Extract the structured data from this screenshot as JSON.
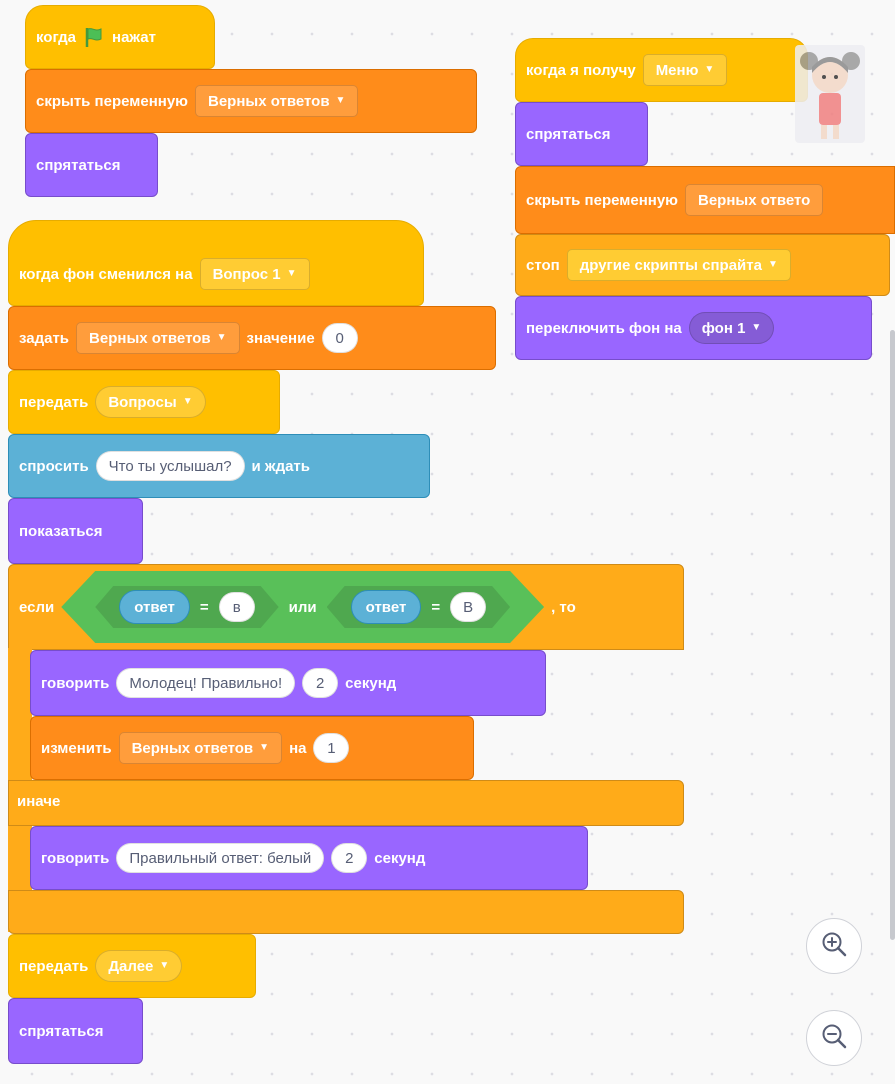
{
  "script1": {
    "hat_when": "когда",
    "hat_clicked": "нажат",
    "hide_var_label": "скрыть переменную",
    "hide_var_value": "Верных ответов",
    "hide_label": "спрятаться"
  },
  "script2": {
    "hat_label": "когда фон сменился на",
    "hat_value": "Вопрос 1",
    "set_label": "задать",
    "set_var": "Верных ответов",
    "set_to": "значение",
    "set_value": "0",
    "broadcast_label": "передать",
    "broadcast_value": "Вопросы",
    "ask_label": "спросить",
    "ask_value": "Что ты услышал?",
    "ask_wait": "и ждать",
    "show_label": "показаться",
    "if_label": "если",
    "answer_1": "ответ",
    "eq_1": "=",
    "value_1": "в",
    "or_label": "или",
    "answer_2": "ответ",
    "eq_2": "=",
    "value_2": "В",
    "then_label": ", то",
    "say1_label": "говорить",
    "say1_value": "Молодец! Правильно!",
    "say1_secs": "2",
    "say1_unit": "секунд",
    "change_label": "изменить",
    "change_var": "Верных ответов",
    "change_by": "на",
    "change_value": "1",
    "else_label": "иначе",
    "say2_label": "говорить",
    "say2_value": "Правильный ответ: белый",
    "say2_secs": "2",
    "say2_unit": "секунд",
    "broadcast2_label": "передать",
    "broadcast2_value": "Далее",
    "hide2_label": "спрятаться"
  },
  "script3": {
    "hat_label": "когда я получу",
    "hat_value": "Меню",
    "hide_label": "спрятаться",
    "hide_var_label": "скрыть переменную",
    "hide_var_value": "Верных ответо",
    "stop_label": "стоп",
    "stop_value": "другие скрипты спрайта",
    "switch_label": "переключить фон на",
    "switch_value": "фон 1"
  },
  "zoom": {
    "in_icon": "zoom-in-icon",
    "out_icon": "zoom-out-icon"
  },
  "colors": {
    "events": "#ffbf00",
    "variables": "#ff8c1a",
    "looks": "#9966ff",
    "sensing": "#5cb1d6",
    "control": "#ffab19",
    "operators": "#59c059"
  }
}
